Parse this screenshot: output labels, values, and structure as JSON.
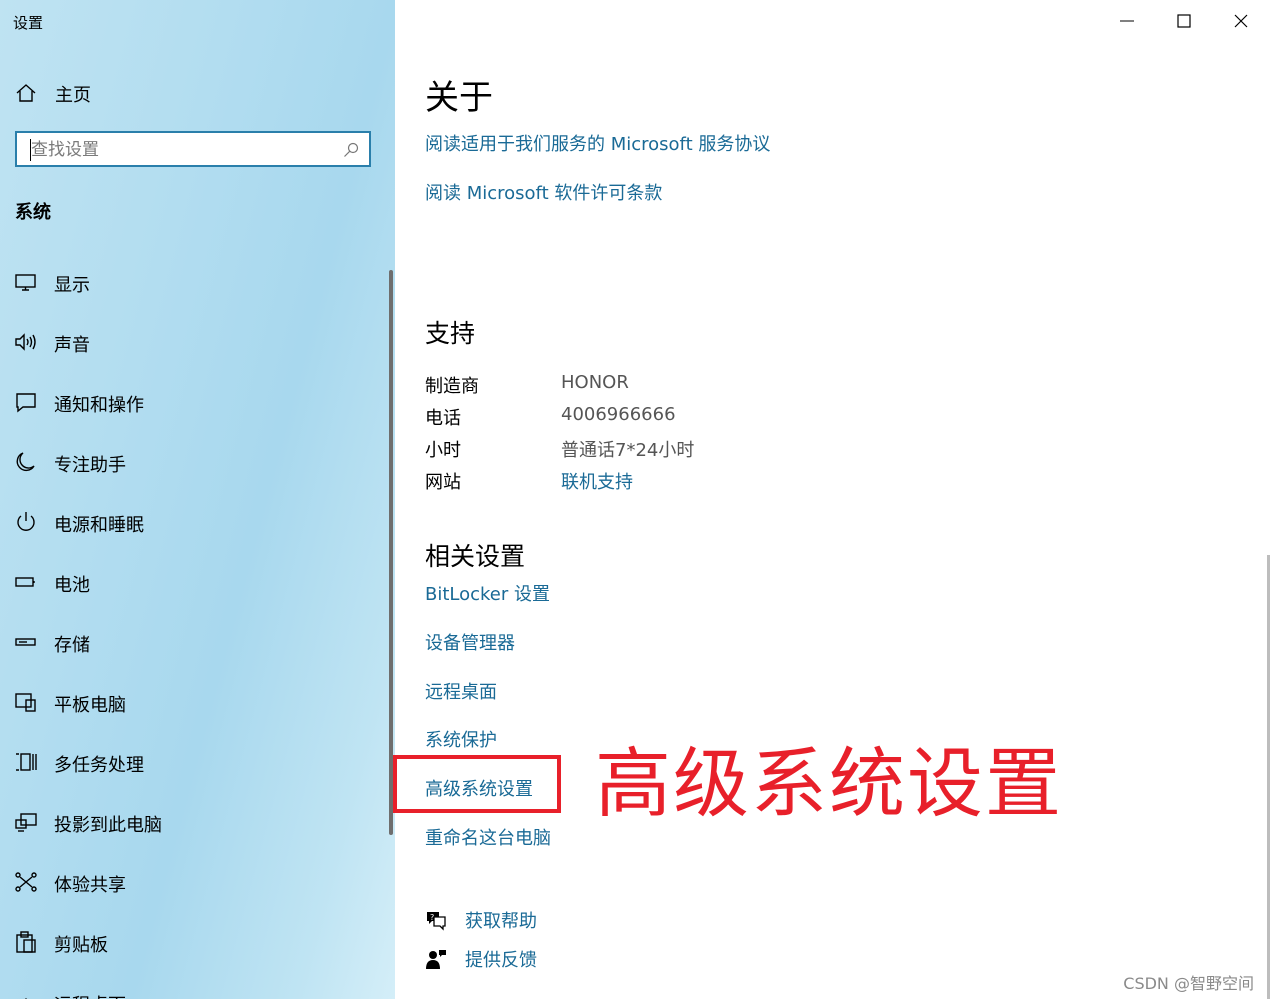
{
  "window": {
    "title": "设置"
  },
  "sidebar": {
    "home_label": "主页",
    "search_placeholder": "查找设置",
    "section_label": "系统",
    "items": [
      {
        "label": "显示",
        "icon": "monitor-icon"
      },
      {
        "label": "声音",
        "icon": "speaker-icon"
      },
      {
        "label": "通知和操作",
        "icon": "notification-icon"
      },
      {
        "label": "专注助手",
        "icon": "moon-icon"
      },
      {
        "label": "电源和睡眠",
        "icon": "power-icon"
      },
      {
        "label": "电池",
        "icon": "battery-icon"
      },
      {
        "label": "存储",
        "icon": "storage-icon"
      },
      {
        "label": "平板电脑",
        "icon": "tablet-icon"
      },
      {
        "label": "多任务处理",
        "icon": "multitask-icon"
      },
      {
        "label": "投影到此电脑",
        "icon": "project-icon"
      },
      {
        "label": "体验共享",
        "icon": "share-icon"
      },
      {
        "label": "剪贴板",
        "icon": "clipboard-icon"
      },
      {
        "label": "远程桌面",
        "icon": "remote-desktop-icon"
      }
    ]
  },
  "main": {
    "about_title": "关于",
    "about_links": [
      "阅读适用于我们服务的 Microsoft 服务协议",
      "阅读 Microsoft 软件许可条款"
    ],
    "support_title": "支持",
    "support": {
      "manufacturer_label": "制造商",
      "manufacturer_value": "HONOR",
      "phone_label": "电话",
      "phone_value": "4006966666",
      "hours_label": "小时",
      "hours_value": "普通话7*24小时",
      "website_label": "网站",
      "website_value": "联机支持"
    },
    "related_title": "相关设置",
    "related_links": [
      "BitLocker 设置",
      "设备管理器",
      "远程桌面",
      "系统保护",
      "高级系统设置",
      "重命名这台电脑"
    ],
    "annotation_text": "高级系统设置",
    "help_label": "获取帮助",
    "feedback_label": "提供反馈"
  },
  "watermark": "CSDN @智野空间",
  "colors": {
    "link": "#1a6a96",
    "annotation": "#e8202a",
    "search_border": "#2a7fab"
  }
}
